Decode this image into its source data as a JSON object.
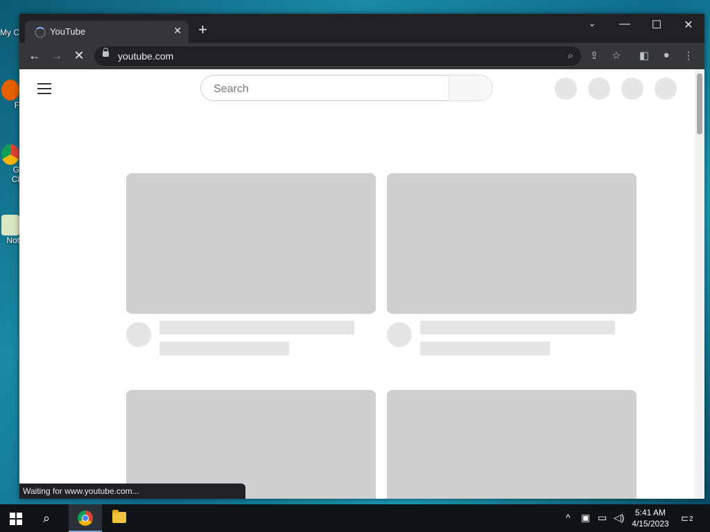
{
  "desktop": {
    "icons": [
      {
        "label": "My C"
      },
      {
        "label": "F"
      },
      {
        "label": "G"
      },
      {
        "label": "Cl"
      },
      {
        "label": "Not"
      }
    ]
  },
  "browser": {
    "tab": {
      "title": "YouTube"
    },
    "omnibox": {
      "url": "youtube.com"
    },
    "status_text": "Waiting for www.youtube.com..."
  },
  "page": {
    "search_placeholder": "Search"
  },
  "taskbar": {
    "time": "5:41 AM",
    "date": "4/15/2023",
    "notification_count": "2"
  },
  "colors": {
    "titlebar": "#202124",
    "toolbar": "#35363a",
    "skeleton_thumb": "#cfcfcf",
    "skeleton_line": "#e5e5e5"
  }
}
